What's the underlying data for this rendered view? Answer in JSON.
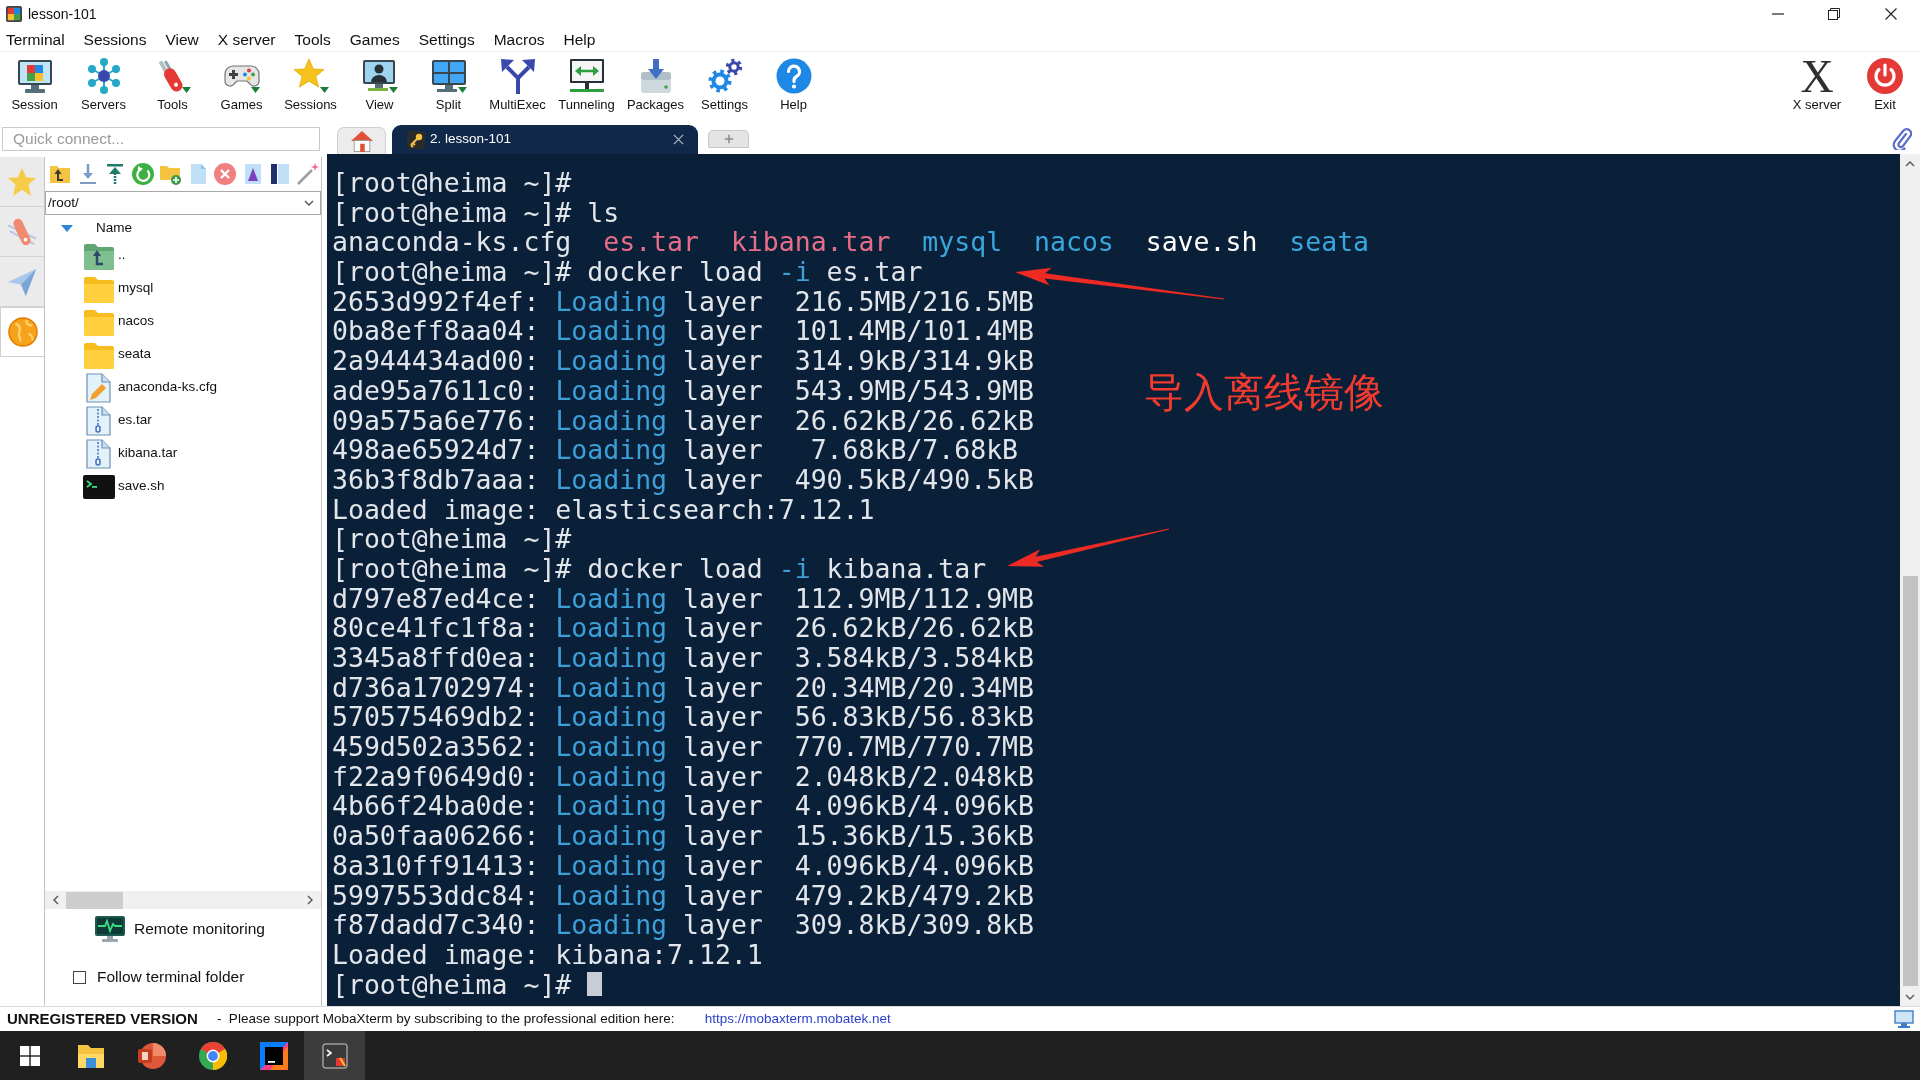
{
  "window": {
    "title": "lesson-101"
  },
  "menu": [
    "Terminal",
    "Sessions",
    "View",
    "X server",
    "Tools",
    "Games",
    "Settings",
    "Macros",
    "Help"
  ],
  "toolbar": {
    "left": [
      "Session",
      "Servers",
      "Tools",
      "Games",
      "Sessions",
      "View",
      "Split",
      "MultiExec",
      "Tunneling",
      "Packages",
      "Settings",
      "Help"
    ],
    "right": [
      {
        "label": "X server",
        "glyph": "X"
      },
      {
        "label": "Exit"
      }
    ]
  },
  "quick_connect": {
    "placeholder": "Quick connect..."
  },
  "tabs": [
    {
      "kind": "home",
      "selected": false
    },
    {
      "kind": "session",
      "label": "2. lesson-101",
      "selected": true
    }
  ],
  "side_tabs": [
    {
      "selected": false
    },
    {
      "selected": false
    },
    {
      "selected": false
    },
    {
      "selected": true
    }
  ],
  "file_browser": {
    "path": "/root/",
    "column": "Name",
    "expanded": true,
    "files": [
      {
        "name": "..",
        "kind": "parent"
      },
      {
        "name": "mysql",
        "kind": "folder"
      },
      {
        "name": "nacos",
        "kind": "folder"
      },
      {
        "name": "seata",
        "kind": "folder"
      },
      {
        "name": "anaconda-ks.cfg",
        "kind": "text"
      },
      {
        "name": "es.tar",
        "kind": "archive"
      },
      {
        "name": "kibana.tar",
        "kind": "archive"
      },
      {
        "name": "save.sh",
        "kind": "script"
      }
    ],
    "remote_monitoring": "Remote monitoring",
    "follow_terminal_folder": {
      "label": "Follow terminal folder",
      "checked": false
    }
  },
  "terminal": {
    "cursor": true,
    "lines": [
      [
        {
          "text": "[root@heima ~]#",
          "kind": "plain"
        }
      ],
      [
        {
          "text": "[root@heima ~]# ls",
          "kind": "plain"
        }
      ],
      [
        {
          "text": "anaconda-ks.cfg",
          "kind": "plain"
        },
        {
          "text": "  es.tar",
          "kind": "archive"
        },
        {
          "text": "  kibana.tar",
          "kind": "archive"
        },
        {
          "text": "  mysql",
          "kind": "directory"
        },
        {
          "text": "  nacos",
          "kind": "directory"
        },
        {
          "text": "  save.sh",
          "kind": "executable"
        },
        {
          "text": "  seata",
          "kind": "directory"
        }
      ],
      [
        {
          "text": "[root@heima ~]# docker load ",
          "kind": "plain"
        },
        {
          "text": "-i",
          "kind": "keyword"
        },
        {
          "text": " es.tar",
          "kind": "plain"
        }
      ],
      [
        {
          "text": "2653d992f4ef: ",
          "kind": "plain"
        },
        {
          "text": "Loading",
          "kind": "keyword"
        },
        {
          "text": " layer  216.5MB/216.5MB",
          "kind": "plain"
        }
      ],
      [
        {
          "text": "0ba8eff8aa04: ",
          "kind": "plain"
        },
        {
          "text": "Loading",
          "kind": "keyword"
        },
        {
          "text": " layer  101.4MB/101.4MB",
          "kind": "plain"
        }
      ],
      [
        {
          "text": "2a944434ad00: ",
          "kind": "plain"
        },
        {
          "text": "Loading",
          "kind": "keyword"
        },
        {
          "text": " layer  314.9kB/314.9kB",
          "kind": "plain"
        }
      ],
      [
        {
          "text": "ade95a7611c0: ",
          "kind": "plain"
        },
        {
          "text": "Loading",
          "kind": "keyword"
        },
        {
          "text": " layer  543.9MB/543.9MB",
          "kind": "plain"
        }
      ],
      [
        {
          "text": "09a575a6e776: ",
          "kind": "plain"
        },
        {
          "text": "Loading",
          "kind": "keyword"
        },
        {
          "text": " layer  26.62kB/26.62kB",
          "kind": "plain"
        }
      ],
      [
        {
          "text": "498ae65924d7: ",
          "kind": "plain"
        },
        {
          "text": "Loading",
          "kind": "keyword"
        },
        {
          "text": " layer   7.68kB/7.68kB",
          "kind": "plain"
        }
      ],
      [
        {
          "text": "36b3f8db7aaa: ",
          "kind": "plain"
        },
        {
          "text": "Loading",
          "kind": "keyword"
        },
        {
          "text": " layer  490.5kB/490.5kB",
          "kind": "plain"
        }
      ],
      [
        {
          "text": "Loaded image: elasticsearch:7.12.1",
          "kind": "plain"
        }
      ],
      [
        {
          "text": "[root@heima ~]#",
          "kind": "plain"
        }
      ],
      [
        {
          "text": "[root@heima ~]# docker load ",
          "kind": "plain"
        },
        {
          "text": "-i",
          "kind": "keyword"
        },
        {
          "text": " kibana.tar",
          "kind": "plain"
        }
      ],
      [
        {
          "text": "d797e87ed4ce: ",
          "kind": "plain"
        },
        {
          "text": "Loading",
          "kind": "keyword"
        },
        {
          "text": " layer  112.9MB/112.9MB",
          "kind": "plain"
        }
      ],
      [
        {
          "text": "80ce41fc1f8a: ",
          "kind": "plain"
        },
        {
          "text": "Loading",
          "kind": "keyword"
        },
        {
          "text": " layer  26.62kB/26.62kB",
          "kind": "plain"
        }
      ],
      [
        {
          "text": "3345a8ffd0ea: ",
          "kind": "plain"
        },
        {
          "text": "Loading",
          "kind": "keyword"
        },
        {
          "text": " layer  3.584kB/3.584kB",
          "kind": "plain"
        }
      ],
      [
        {
          "text": "d736a1702974: ",
          "kind": "plain"
        },
        {
          "text": "Loading",
          "kind": "keyword"
        },
        {
          "text": " layer  20.34MB/20.34MB",
          "kind": "plain"
        }
      ],
      [
        {
          "text": "570575469db2: ",
          "kind": "plain"
        },
        {
          "text": "Loading",
          "kind": "keyword"
        },
        {
          "text": " layer  56.83kB/56.83kB",
          "kind": "plain"
        }
      ],
      [
        {
          "text": "459d502a3562: ",
          "kind": "plain"
        },
        {
          "text": "Loading",
          "kind": "keyword"
        },
        {
          "text": " layer  770.7MB/770.7MB",
          "kind": "plain"
        }
      ],
      [
        {
          "text": "f22a9f0649d0: ",
          "kind": "plain"
        },
        {
          "text": "Loading",
          "kind": "keyword"
        },
        {
          "text": " layer  2.048kB/2.048kB",
          "kind": "plain"
        }
      ],
      [
        {
          "text": "4b66f24ba0de: ",
          "kind": "plain"
        },
        {
          "text": "Loading",
          "kind": "keyword"
        },
        {
          "text": " layer  4.096kB/4.096kB",
          "kind": "plain"
        }
      ],
      [
        {
          "text": "0a50faa06266: ",
          "kind": "plain"
        },
        {
          "text": "Loading",
          "kind": "keyword"
        },
        {
          "text": " layer  15.36kB/15.36kB",
          "kind": "plain"
        }
      ],
      [
        {
          "text": "8a310ff91413: ",
          "kind": "plain"
        },
        {
          "text": "Loading",
          "kind": "keyword"
        },
        {
          "text": " layer  4.096kB/4.096kB",
          "kind": "plain"
        }
      ],
      [
        {
          "text": "5997553ddc84: ",
          "kind": "plain"
        },
        {
          "text": "Loading",
          "kind": "keyword"
        },
        {
          "text": " layer  479.2kB/479.2kB",
          "kind": "plain"
        }
      ],
      [
        {
          "text": "f87dadd7c340: ",
          "kind": "plain"
        },
        {
          "text": "Loading",
          "kind": "keyword"
        },
        {
          "text": " layer  309.8kB/309.8kB",
          "kind": "plain"
        }
      ],
      [
        {
          "text": "Loaded image: kibana:7.12.1",
          "kind": "plain"
        }
      ],
      [
        {
          "text": "[root@heima ~]#",
          "kind": "plain"
        }
      ]
    ]
  },
  "annotation": {
    "text": "导入离线镜像"
  },
  "status_bar": {
    "edition": "UNREGISTERED VERSION",
    "message": "-  Please support MobaXterm by subscribing to the professional edition here:",
    "link": "https://mobaxterm.mobatek.net"
  },
  "taskbar": {
    "apps": [
      {
        "selected": false
      },
      {
        "selected": false
      },
      {
        "selected": false
      },
      {
        "selected": false
      },
      {
        "selected": true
      }
    ]
  }
}
